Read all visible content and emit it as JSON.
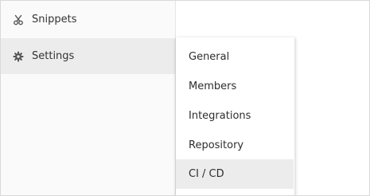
{
  "sidebar": {
    "items": [
      {
        "label": "Snippets",
        "icon": "scissors-icon"
      },
      {
        "label": "Settings",
        "icon": "gear-icon",
        "active": true
      }
    ]
  },
  "settings_flyout": {
    "items": [
      {
        "label": "General"
      },
      {
        "label": "Members"
      },
      {
        "label": "Integrations"
      },
      {
        "label": "Repository"
      },
      {
        "label": "CI / CD",
        "highlighted": true
      }
    ]
  },
  "colors": {
    "sidebar_bg": "#fafafa",
    "active_bg": "#ececec",
    "text": "#333333",
    "border": "#d9d9d9"
  }
}
